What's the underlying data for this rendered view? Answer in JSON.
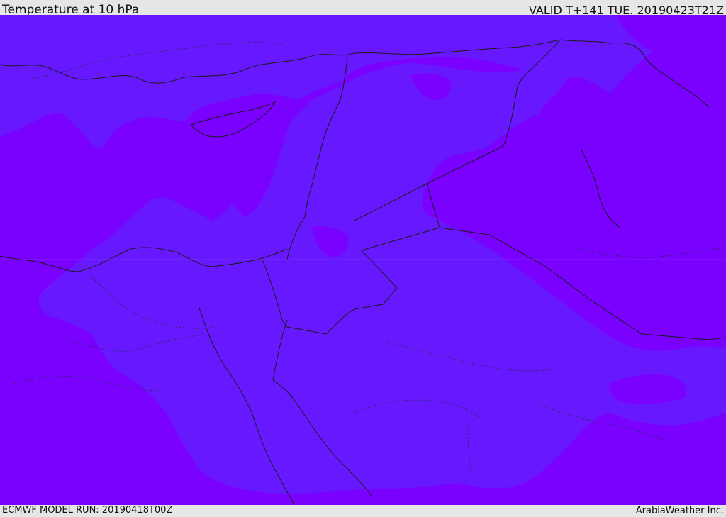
{
  "header": {
    "title": "Temperature at 10 hPa",
    "valid_time": "VALID T+141 TUE. 20190423T21Z"
  },
  "footer": {
    "model_run": "ECMWF MODEL RUN: 20190418T00Z",
    "credit": "ArabiaWeather Inc."
  },
  "map": {
    "colors": {
      "cold_band": "#7a00ff",
      "mid_band": "#6818ff",
      "coastline": "#1a1a1a"
    }
  }
}
